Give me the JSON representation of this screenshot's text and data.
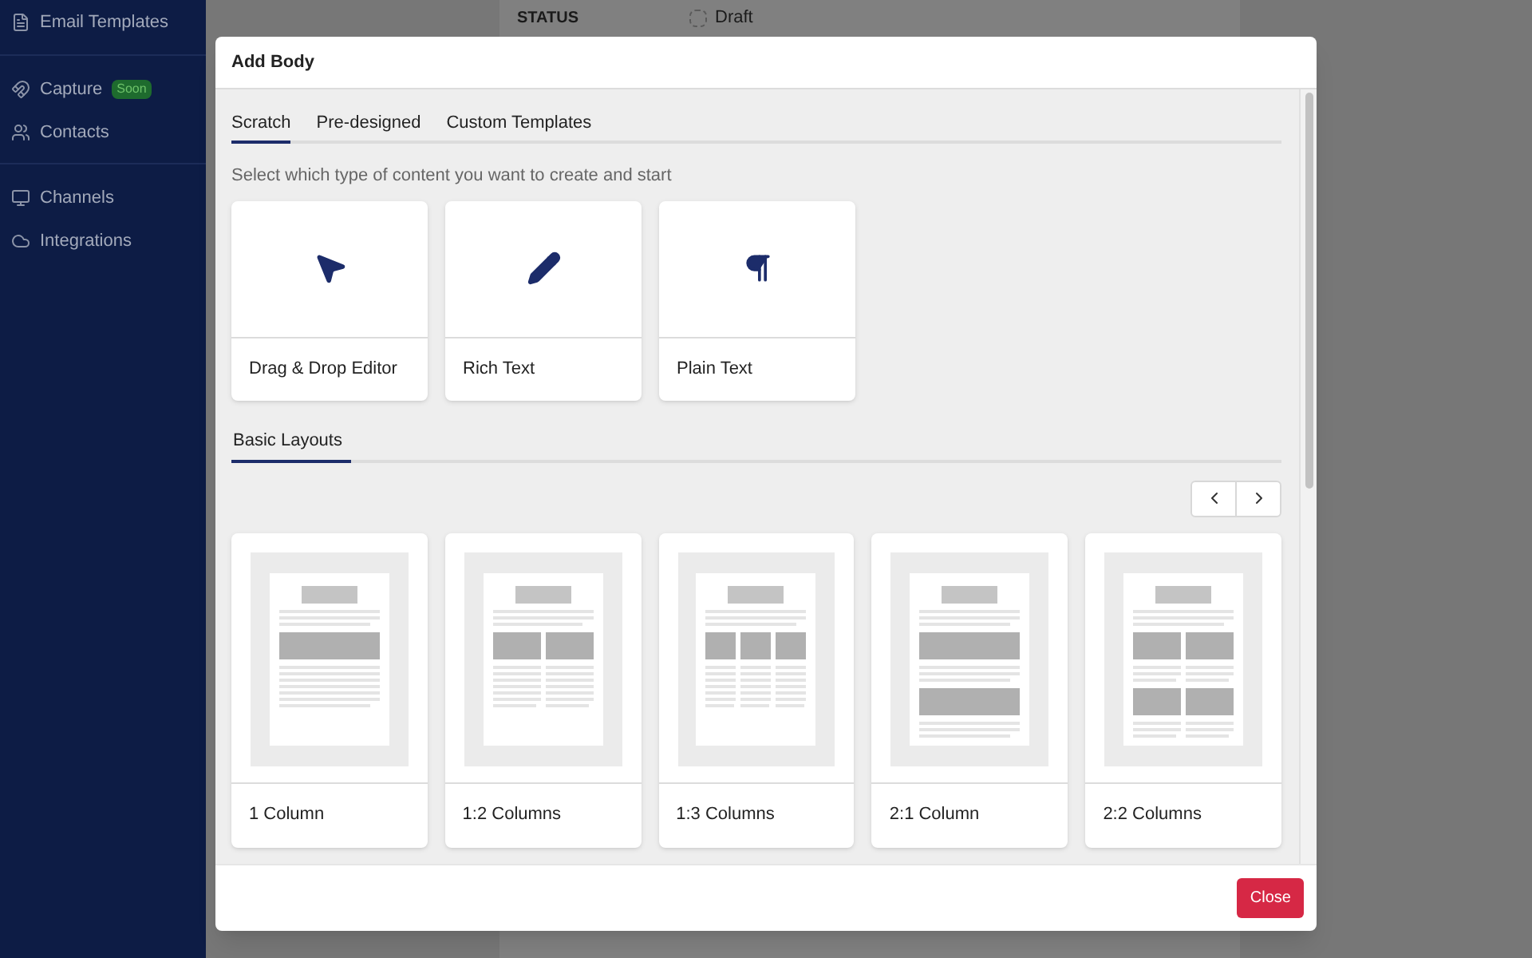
{
  "sidebar": {
    "groups": [
      [
        {
          "label": "Email Templates",
          "kind": "file"
        }
      ],
      [
        {
          "label": "Capture",
          "kind": "magnet",
          "badge": "Soon"
        },
        {
          "label": "Contacts",
          "kind": "users"
        }
      ],
      [
        {
          "label": "Channels",
          "kind": "channels"
        },
        {
          "label": "Integrations",
          "kind": "cloud"
        }
      ]
    ]
  },
  "background_page": {
    "field_label": "STATUS",
    "checkbox": {
      "label": "Draft",
      "checked": false
    }
  },
  "dialog": {
    "title": "Add Body",
    "tabs": [
      {
        "label": "Scratch",
        "selected": true
      },
      {
        "label": "Pre-designed",
        "selected": false
      },
      {
        "label": "Custom Templates",
        "selected": false
      }
    ],
    "instruction": "Select which type of content you want to create and start",
    "content_types": [
      {
        "label": "Drag & Drop Editor",
        "kind": "pointer"
      },
      {
        "label": "Rich Text",
        "kind": "pencil"
      },
      {
        "label": "Plain Text",
        "kind": "pilcrow"
      }
    ],
    "section_tabs": [
      {
        "label": "Basic Layouts",
        "selected": true
      }
    ],
    "layouts": [
      {
        "label": "1 Column",
        "kind": "one"
      },
      {
        "label": "1:2 Columns",
        "kind": "two"
      },
      {
        "label": "1:3 Columns",
        "kind": "three"
      },
      {
        "label": "2:1 Column",
        "kind": "twoone"
      },
      {
        "label": "2:2 Columns",
        "kind": "twotwo"
      }
    ],
    "close_button": "Close"
  }
}
